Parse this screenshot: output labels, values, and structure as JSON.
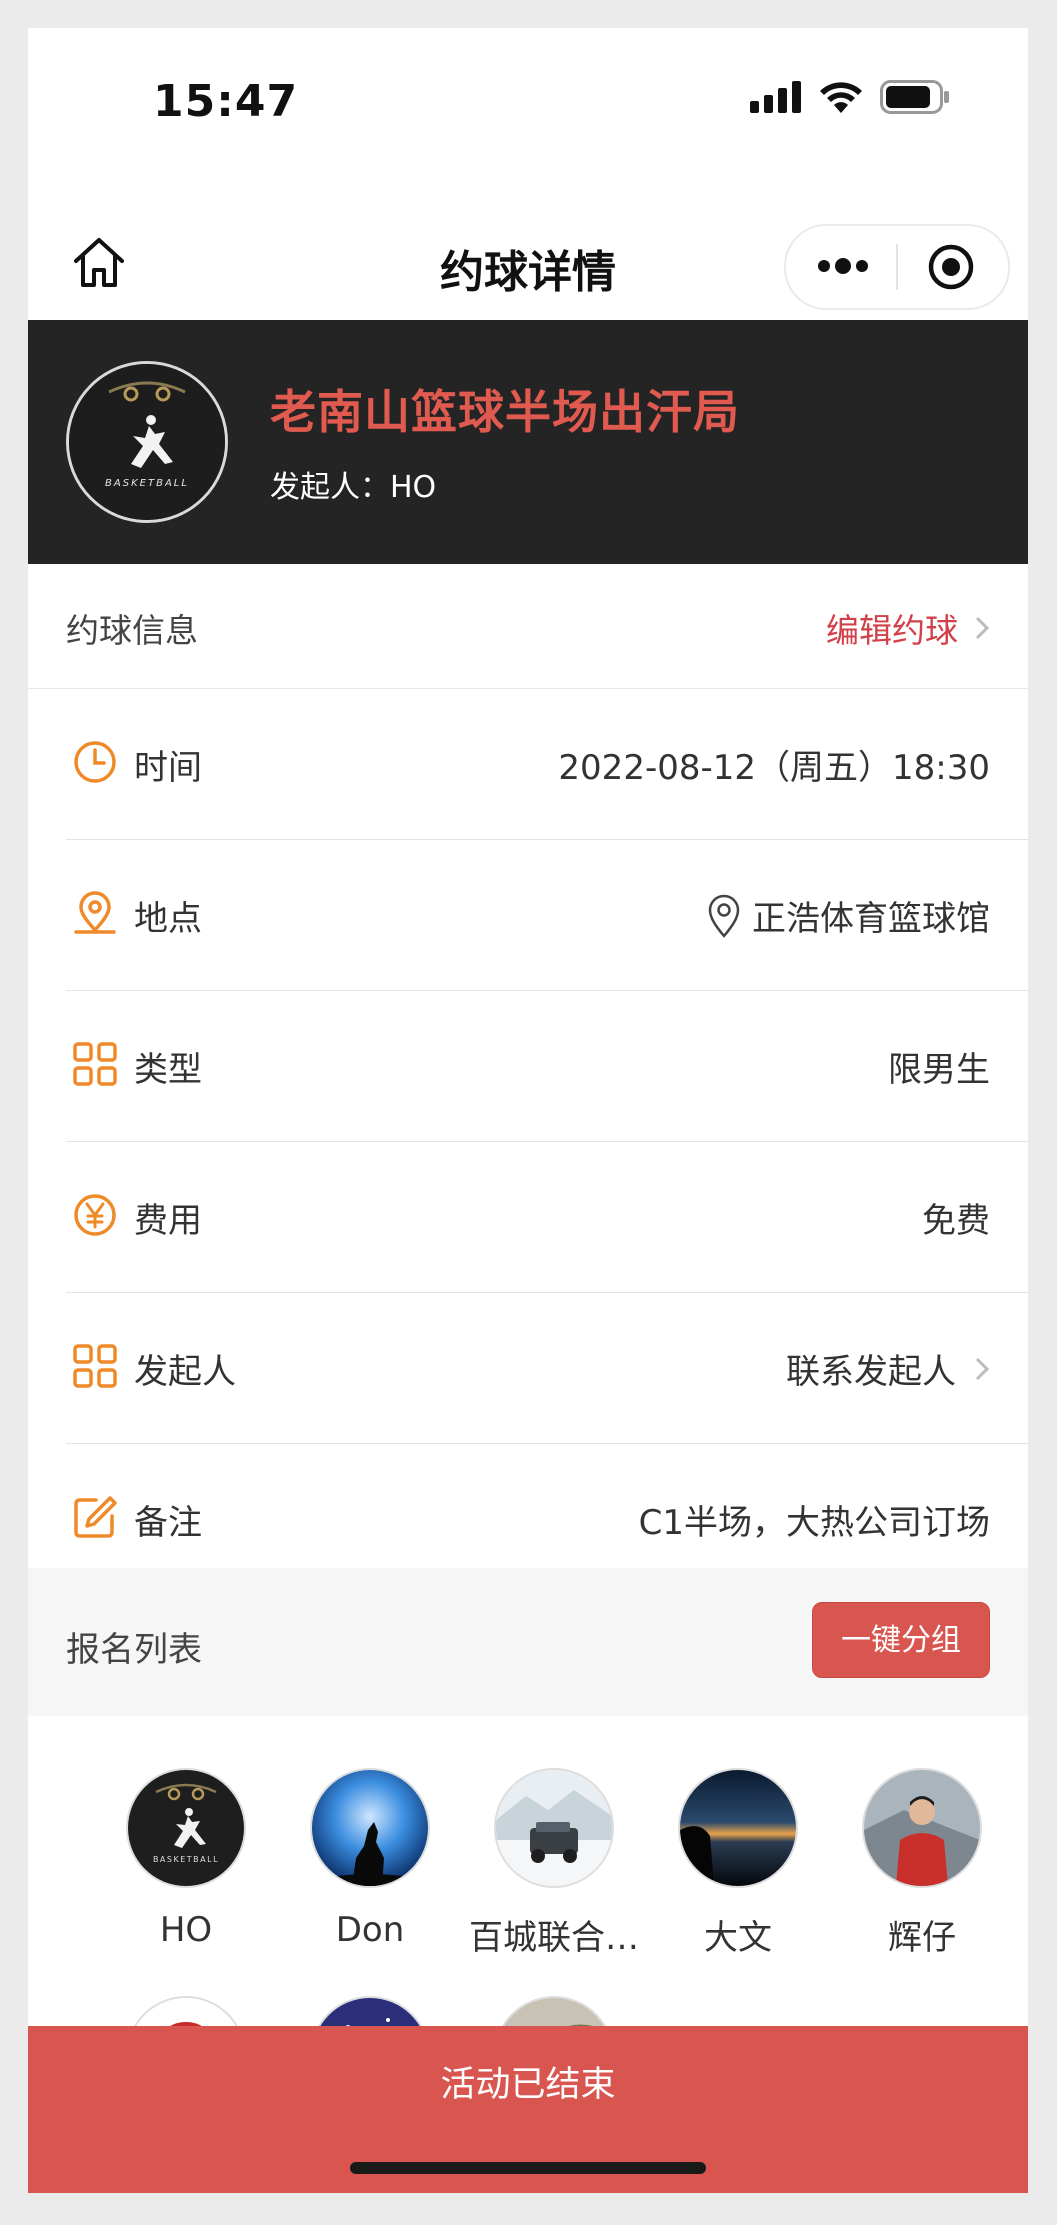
{
  "status_bar": {
    "time": "15:47"
  },
  "nav": {
    "title": "约球详情"
  },
  "header": {
    "title": "老南山篮球半场出汗局",
    "organizer_line": "发起人：HO"
  },
  "info_section": {
    "label": "约球信息",
    "edit_label": "编辑约球",
    "rows": [
      {
        "icon": "clock-icon",
        "label": "时间",
        "value": "2022-08-12（周五）18:30"
      },
      {
        "icon": "location-icon",
        "label": "地点",
        "value": "正浩体育篮球馆"
      },
      {
        "icon": "grid-icon",
        "label": "类型",
        "value": "限男生"
      },
      {
        "icon": "yen-icon",
        "label": "费用",
        "value": "免费"
      },
      {
        "icon": "grid-icon",
        "label": "发起人",
        "value": "联系发起人"
      },
      {
        "icon": "edit-icon",
        "label": "备注",
        "value": "C1半场，大热公司订场"
      }
    ]
  },
  "signup": {
    "label": "报名列表",
    "group_button": "一键分组",
    "members": [
      {
        "name": "HO"
      },
      {
        "name": "Don"
      },
      {
        "name": "百城联合…"
      },
      {
        "name": "大文"
      },
      {
        "name": "辉仔"
      }
    ]
  },
  "bottom_bar": {
    "label": "活动已结束"
  },
  "colors": {
    "accent": "#d95550",
    "icon_orange": "#ef8a2a",
    "title_red": "#e05a4f",
    "banner_bg": "#242424"
  }
}
